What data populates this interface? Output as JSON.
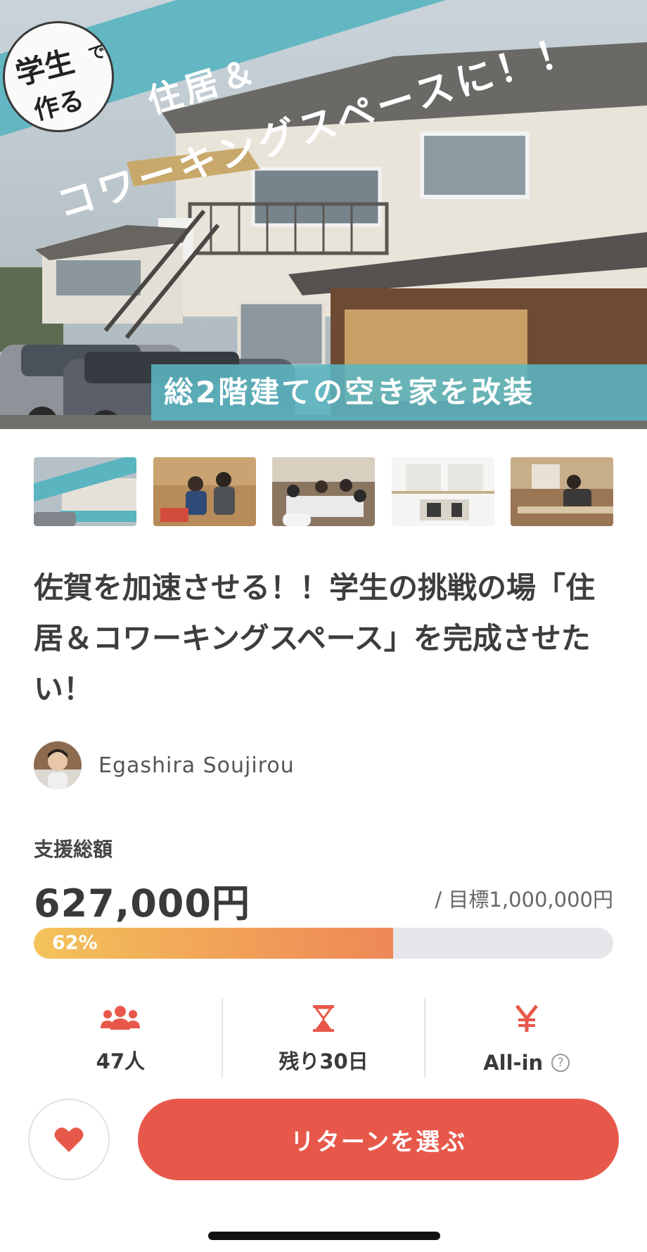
{
  "hero": {
    "badge_line1": "学生",
    "badge_line1_small": "で",
    "badge_line2": "作る",
    "banner_line1": "住居＆",
    "banner_line2": "コワーキングスペースに！！",
    "caption": "総2階建ての空き家を改装",
    "banner_color": "#5bb5c1"
  },
  "thumbnails": [
    {
      "name": "thumb-cover"
    },
    {
      "name": "thumb-two-people"
    },
    {
      "name": "thumb-meeting"
    },
    {
      "name": "thumb-floorplan"
    },
    {
      "name": "thumb-renovation"
    }
  ],
  "project": {
    "title": "佐賀を加速させる！！学生の挑戦の場「住居＆コワーキングスペース」を完成させたい！",
    "author": "Egashira Soujirou"
  },
  "funding": {
    "label": "支援総額",
    "amount": "627,000円",
    "goal": "/ 目標1,000,000円",
    "percent_label": "62%",
    "progress_fraction": 0.62,
    "accent": "#e8584a"
  },
  "stats": [
    {
      "icon": "people-icon",
      "value": "47人"
    },
    {
      "icon": "hourglass-icon",
      "value": "残り30日"
    },
    {
      "icon": "yen-icon",
      "value": "All-in",
      "help_icon": "?"
    }
  ],
  "actions": {
    "favorite_icon": "heart-icon",
    "cta_label": "リターンを選ぶ"
  }
}
